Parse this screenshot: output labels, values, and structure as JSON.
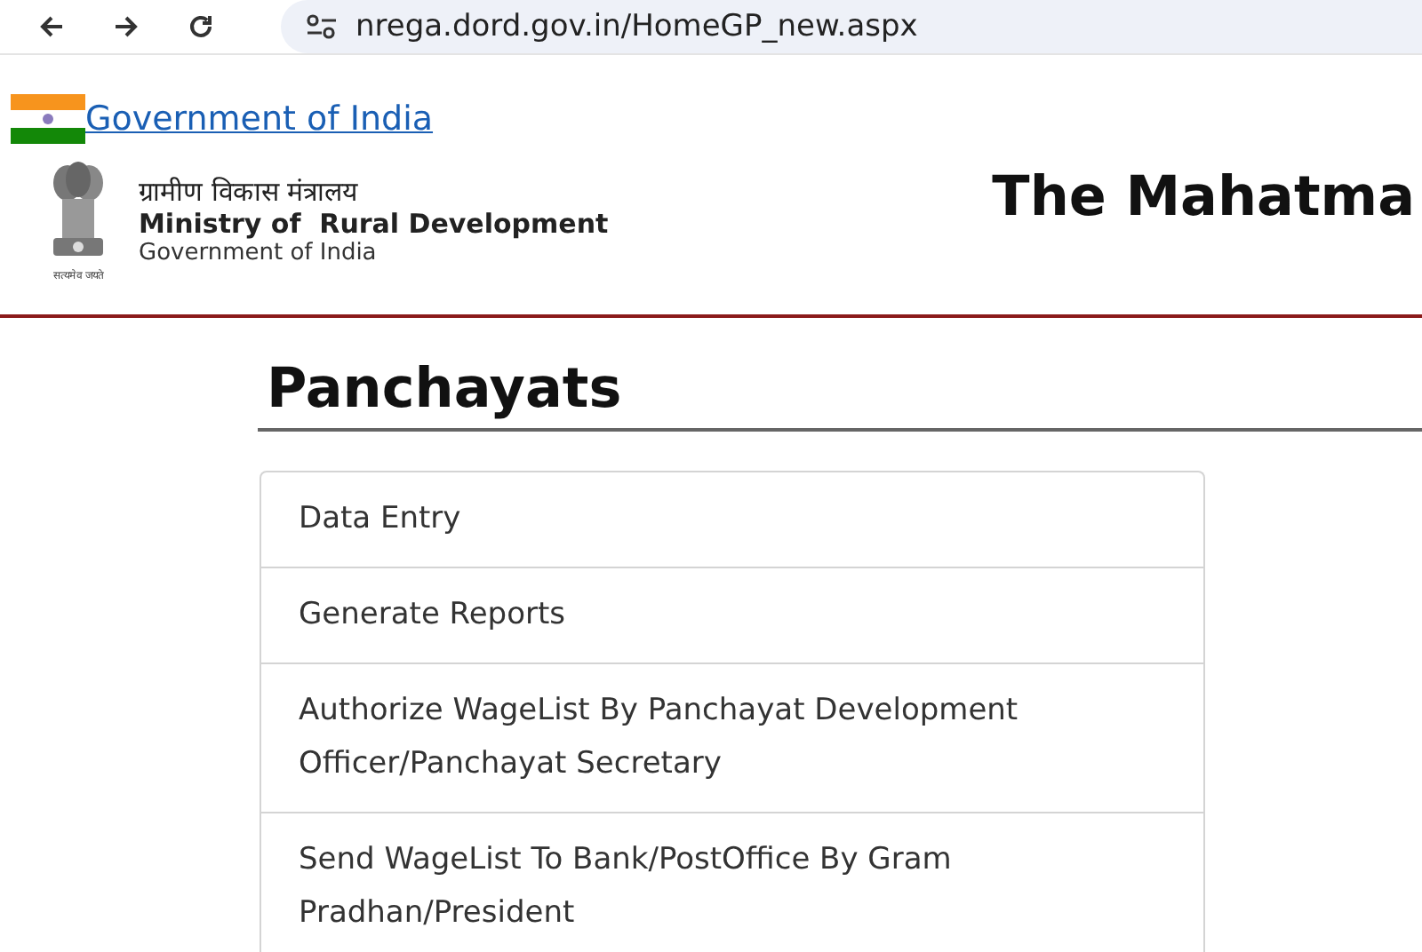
{
  "browser": {
    "url": "nrega.dord.gov.in/HomeGP_new.aspx"
  },
  "top_link": "Government of India",
  "header": {
    "hindi_name": "ग्रामीण विकास मंत्रालय",
    "ministry": "Ministry of  Rural Development",
    "government": "Government of India",
    "motto": "सत्यमेव जयते",
    "title": "The Mahatma"
  },
  "section": {
    "heading": "Panchayats",
    "items": [
      {
        "label": "Data Entry"
      },
      {
        "label": "Generate Reports"
      },
      {
        "label": "Authorize WageList By Panchayat Development Officer/Panchayat Secretary"
      },
      {
        "label": "Send WageList To Bank/PostOffice By Gram Pradhan/President"
      }
    ]
  }
}
